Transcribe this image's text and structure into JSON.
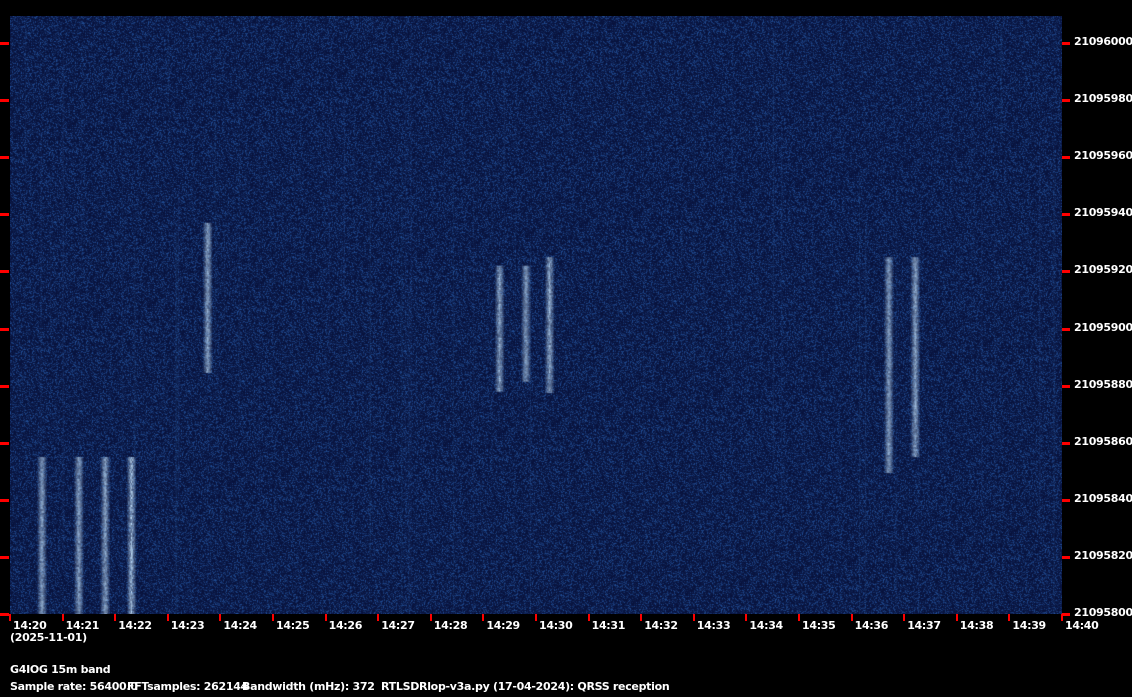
{
  "chart_data": {
    "type": "heatmap",
    "title": "QRSS reception spectrogram",
    "x_ticks": [
      "14:20",
      "14:21",
      "14:22",
      "14:23",
      "14:24",
      "14:25",
      "14:26",
      "14:27",
      "14:28",
      "14:29",
      "14:30",
      "14:31",
      "14:32",
      "14:33",
      "14:34",
      "14:35",
      "14:36",
      "14:37",
      "14:38",
      "14:39",
      "14:40"
    ],
    "y_ticks": [
      "21096000",
      "21095980",
      "21095960",
      "21095940",
      "21095920",
      "21095900",
      "21095880",
      "21095860",
      "21095840",
      "21095820",
      "21095800"
    ],
    "ylim": [
      21095800,
      21096010
    ],
    "xlim": [
      "14:20",
      "14:40"
    ],
    "date": "(2025-11-01)",
    "signals": [
      {
        "time_min": 0.6,
        "freq_low": 21095800,
        "freq_high": 21095855
      },
      {
        "time_min": 1.3,
        "freq_low": 21095800,
        "freq_high": 21095855
      },
      {
        "time_min": 1.8,
        "freq_low": 21095800,
        "freq_high": 21095855
      },
      {
        "time_min": 2.3,
        "freq_low": 21095800,
        "freq_high": 21095855
      },
      {
        "time_min": 3.75,
        "freq_low": 21095885,
        "freq_high": 21095937
      },
      {
        "time_min": 9.3,
        "freq_low": 21095878,
        "freq_high": 21095922
      },
      {
        "time_min": 9.8,
        "freq_low": 21095882,
        "freq_high": 21095922
      },
      {
        "time_min": 10.25,
        "freq_low": 21095878,
        "freq_high": 21095925
      },
      {
        "time_min": 16.7,
        "freq_low": 21095850,
        "freq_high": 21095925
      },
      {
        "time_min": 17.2,
        "freq_low": 21095855,
        "freq_high": 21095925
      }
    ]
  },
  "footer": {
    "station": "G4IOG 15m band",
    "sample_rate": "Sample rate: 56400.0",
    "fft": "FFTsamples: 262144",
    "bandwidth": "Bandwidth (mHz): 372",
    "program": "RTLSDRlop-v3a.py (17-04-2024): QRSS reception"
  },
  "colors": {
    "background": "#000000",
    "noise": "#0c1a4a",
    "signal": "#e0f0ff",
    "tick": "#ff0000"
  }
}
